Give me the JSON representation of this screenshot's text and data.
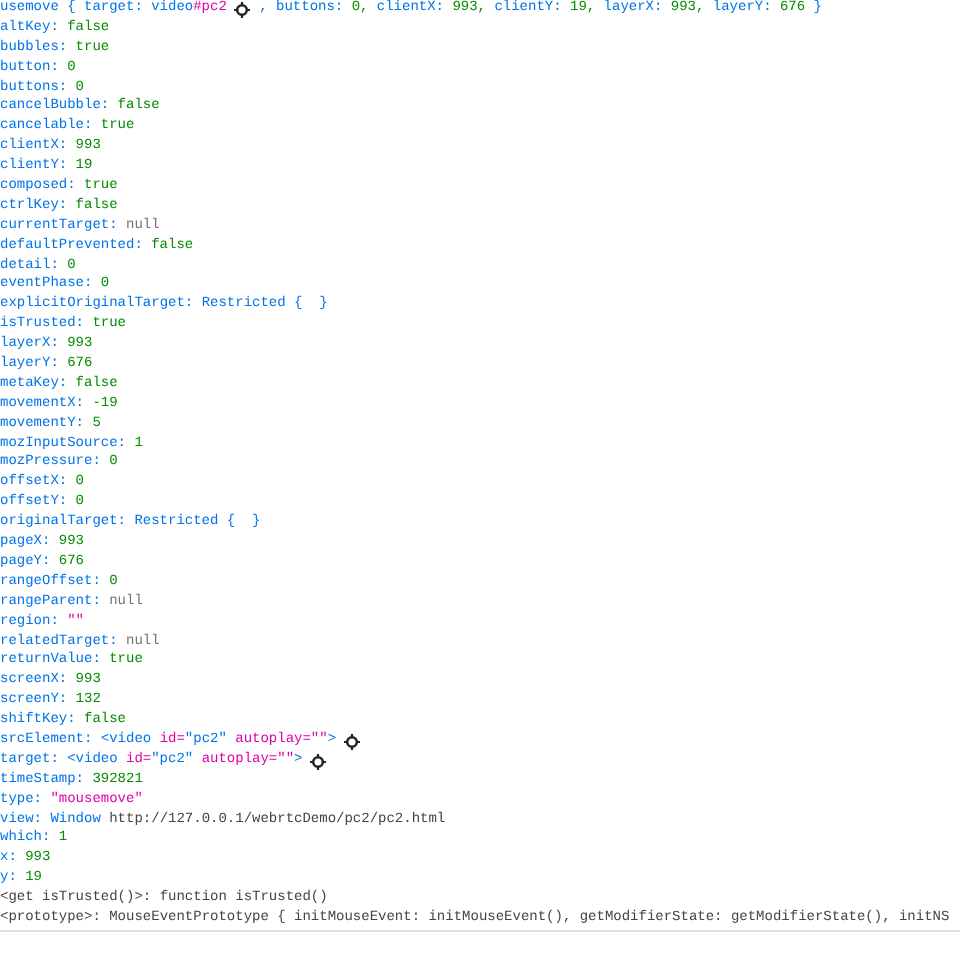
{
  "lines": [
    {
      "tokens": [
        {
          "t": "usemove {",
          "kind": "obj"
        },
        {
          "t": "target:",
          "kind": "key"
        },
        {
          "t": "video",
          "kind": "obj"
        },
        {
          "t": "#pc2",
          "kind": "str",
          "join": true
        },
        {
          "kind": "icon"
        },
        {
          "t": ", buttons:",
          "kind": "key"
        },
        {
          "t": "0,",
          "kind": "num"
        },
        {
          "t": "clientX:",
          "kind": "key"
        },
        {
          "t": "993,",
          "kind": "num"
        },
        {
          "t": "clientY:",
          "kind": "key"
        },
        {
          "t": "19,",
          "kind": "num"
        },
        {
          "t": "layerX:",
          "kind": "key"
        },
        {
          "t": "993,",
          "kind": "num"
        },
        {
          "t": "layerY:",
          "kind": "key"
        },
        {
          "t": "676",
          "kind": "num"
        },
        {
          "t": "}",
          "kind": "obj"
        }
      ]
    },
    {
      "tokens": [
        {
          "t": "altKey:",
          "kind": "key"
        },
        {
          "t": "false",
          "kind": "num"
        }
      ]
    },
    {
      "tokens": [
        {
          "t": "bubbles:",
          "kind": "key"
        },
        {
          "t": "true",
          "kind": "num"
        }
      ]
    },
    {
      "tokens": [
        {
          "t": "button:",
          "kind": "key"
        },
        {
          "t": "0",
          "kind": "num"
        }
      ]
    },
    {
      "tokens": [
        {
          "t": "buttons:",
          "kind": "key"
        },
        {
          "t": "0",
          "kind": "num"
        }
      ]
    },
    {
      "tokens": [
        {
          "t": "cancelBubble:",
          "kind": "key"
        },
        {
          "t": "false",
          "kind": "num"
        }
      ]
    },
    {
      "tokens": [
        {
          "t": "cancelable:",
          "kind": "key"
        },
        {
          "t": "true",
          "kind": "num"
        }
      ]
    },
    {
      "tokens": [
        {
          "t": "clientX:",
          "kind": "key"
        },
        {
          "t": "993",
          "kind": "num"
        }
      ]
    },
    {
      "tokens": [
        {
          "t": "clientY:",
          "kind": "key"
        },
        {
          "t": "19",
          "kind": "num"
        }
      ]
    },
    {
      "tokens": [
        {
          "t": "composed:",
          "kind": "key"
        },
        {
          "t": "true",
          "kind": "num"
        }
      ]
    },
    {
      "tokens": [
        {
          "t": "ctrlKey:",
          "kind": "key"
        },
        {
          "t": "false",
          "kind": "num"
        }
      ]
    },
    {
      "tokens": [
        {
          "t": "currentTarget:",
          "kind": "key"
        },
        {
          "t": "null",
          "kind": "nul"
        }
      ]
    },
    {
      "tokens": [
        {
          "t": "defaultPrevented:",
          "kind": "key"
        },
        {
          "t": "false",
          "kind": "num"
        }
      ]
    },
    {
      "tokens": [
        {
          "t": "detail:",
          "kind": "key"
        },
        {
          "t": "0",
          "kind": "num"
        }
      ]
    },
    {
      "tokens": [
        {
          "t": "eventPhase:",
          "kind": "key"
        },
        {
          "t": "0",
          "kind": "num"
        }
      ]
    },
    {
      "tokens": [
        {
          "t": "explicitOriginalTarget:",
          "kind": "key"
        },
        {
          "t": "Restricted {  }",
          "kind": "obj"
        }
      ]
    },
    {
      "tokens": [
        {
          "t": "isTrusted:",
          "kind": "key"
        },
        {
          "t": "true",
          "kind": "num"
        }
      ]
    },
    {
      "tokens": [
        {
          "t": "layerX:",
          "kind": "key"
        },
        {
          "t": "993",
          "kind": "num"
        }
      ]
    },
    {
      "tokens": [
        {
          "t": "layerY:",
          "kind": "key"
        },
        {
          "t": "676",
          "kind": "num"
        }
      ]
    },
    {
      "tokens": [
        {
          "t": "metaKey:",
          "kind": "key"
        },
        {
          "t": "false",
          "kind": "num"
        }
      ]
    },
    {
      "tokens": [
        {
          "t": "movementX:",
          "kind": "key"
        },
        {
          "t": "-19",
          "kind": "num"
        }
      ]
    },
    {
      "tokens": [
        {
          "t": "movementY:",
          "kind": "key"
        },
        {
          "t": "5",
          "kind": "num"
        }
      ]
    },
    {
      "tokens": [
        {
          "t": "mozInputSource:",
          "kind": "key"
        },
        {
          "t": "1",
          "kind": "num"
        }
      ]
    },
    {
      "tokens": [
        {
          "t": "mozPressure:",
          "kind": "key"
        },
        {
          "t": "0",
          "kind": "num"
        }
      ]
    },
    {
      "tokens": [
        {
          "t": "offsetX:",
          "kind": "key"
        },
        {
          "t": "0",
          "kind": "num"
        }
      ]
    },
    {
      "tokens": [
        {
          "t": "offsetY:",
          "kind": "key"
        },
        {
          "t": "0",
          "kind": "num"
        }
      ]
    },
    {
      "tokens": [
        {
          "t": "originalTarget:",
          "kind": "key"
        },
        {
          "t": "Restricted {  }",
          "kind": "obj"
        }
      ]
    },
    {
      "tokens": [
        {
          "t": "pageX:",
          "kind": "key"
        },
        {
          "t": "993",
          "kind": "num"
        }
      ]
    },
    {
      "tokens": [
        {
          "t": "pageY:",
          "kind": "key"
        },
        {
          "t": "676",
          "kind": "num"
        }
      ]
    },
    {
      "tokens": [
        {
          "t": "rangeOffset:",
          "kind": "key"
        },
        {
          "t": "0",
          "kind": "num"
        }
      ]
    },
    {
      "tokens": [
        {
          "t": "rangeParent:",
          "kind": "key"
        },
        {
          "t": "null",
          "kind": "nul"
        }
      ]
    },
    {
      "tokens": [
        {
          "t": "region:",
          "kind": "key"
        },
        {
          "t": "\"\"",
          "kind": "str"
        }
      ]
    },
    {
      "tokens": [
        {
          "t": "relatedTarget:",
          "kind": "key"
        },
        {
          "t": "null",
          "kind": "nul"
        }
      ]
    },
    {
      "tokens": [
        {
          "t": "returnValue:",
          "kind": "key"
        },
        {
          "t": "true",
          "kind": "num"
        }
      ]
    },
    {
      "tokens": [
        {
          "t": "screenX:",
          "kind": "key"
        },
        {
          "t": "993",
          "kind": "num"
        }
      ]
    },
    {
      "tokens": [
        {
          "t": "screenY:",
          "kind": "key"
        },
        {
          "t": "132",
          "kind": "num"
        }
      ]
    },
    {
      "tokens": [
        {
          "t": "shiftKey:",
          "kind": "key"
        },
        {
          "t": "false",
          "kind": "num"
        }
      ]
    },
    {
      "tokens": [
        {
          "t": "srcElement:",
          "kind": "key"
        },
        {
          "t": "<video",
          "kind": "obj"
        },
        {
          "t": "id=",
          "kind": "str"
        },
        {
          "t": "\"pc2\"",
          "kind": "obj",
          "join": true
        },
        {
          "t": "autoplay=\"\"",
          "kind": "str"
        },
        {
          "t": ">",
          "kind": "obj",
          "join": true
        },
        {
          "kind": "icon"
        }
      ]
    },
    {
      "tokens": [
        {
          "t": "target:",
          "kind": "key"
        },
        {
          "t": "<video",
          "kind": "obj"
        },
        {
          "t": "id=",
          "kind": "str"
        },
        {
          "t": "\"pc2\"",
          "kind": "obj",
          "join": true
        },
        {
          "t": "autoplay=\"\"",
          "kind": "str"
        },
        {
          "t": ">",
          "kind": "obj",
          "join": true
        },
        {
          "kind": "icon"
        }
      ]
    },
    {
      "tokens": [
        {
          "t": "timeStamp:",
          "kind": "key"
        },
        {
          "t": "392821",
          "kind": "num"
        }
      ]
    },
    {
      "tokens": [
        {
          "t": "type:",
          "kind": "key"
        },
        {
          "t": "\"mousemove\"",
          "kind": "str"
        }
      ]
    },
    {
      "tokens": [
        {
          "t": "view:",
          "kind": "key"
        },
        {
          "t": "Window",
          "kind": "obj"
        },
        {
          "t": "http://127.0.0.1/webrtcDemo/pc2/pc2.html",
          "kind": "plain"
        }
      ]
    },
    {
      "tokens": [
        {
          "t": "which:",
          "kind": "key"
        },
        {
          "t": "1",
          "kind": "num"
        }
      ]
    },
    {
      "tokens": [
        {
          "t": "x:",
          "kind": "key"
        },
        {
          "t": "993",
          "kind": "num"
        }
      ]
    },
    {
      "tokens": [
        {
          "t": "y:",
          "kind": "key"
        },
        {
          "t": "19",
          "kind": "num"
        }
      ]
    },
    {
      "tokens": [
        {
          "t": "<get isTrusted()>:",
          "kind": "plain"
        },
        {
          "t": "function isTrusted()",
          "kind": "plain"
        }
      ]
    },
    {
      "tokens": [
        {
          "t": "<prototype>:",
          "kind": "plain"
        },
        {
          "t": "MouseEventPrototype { initMouseEvent: initMouseEvent(), getModifierState: getModifierState(), initNS",
          "kind": "plain"
        }
      ]
    }
  ]
}
